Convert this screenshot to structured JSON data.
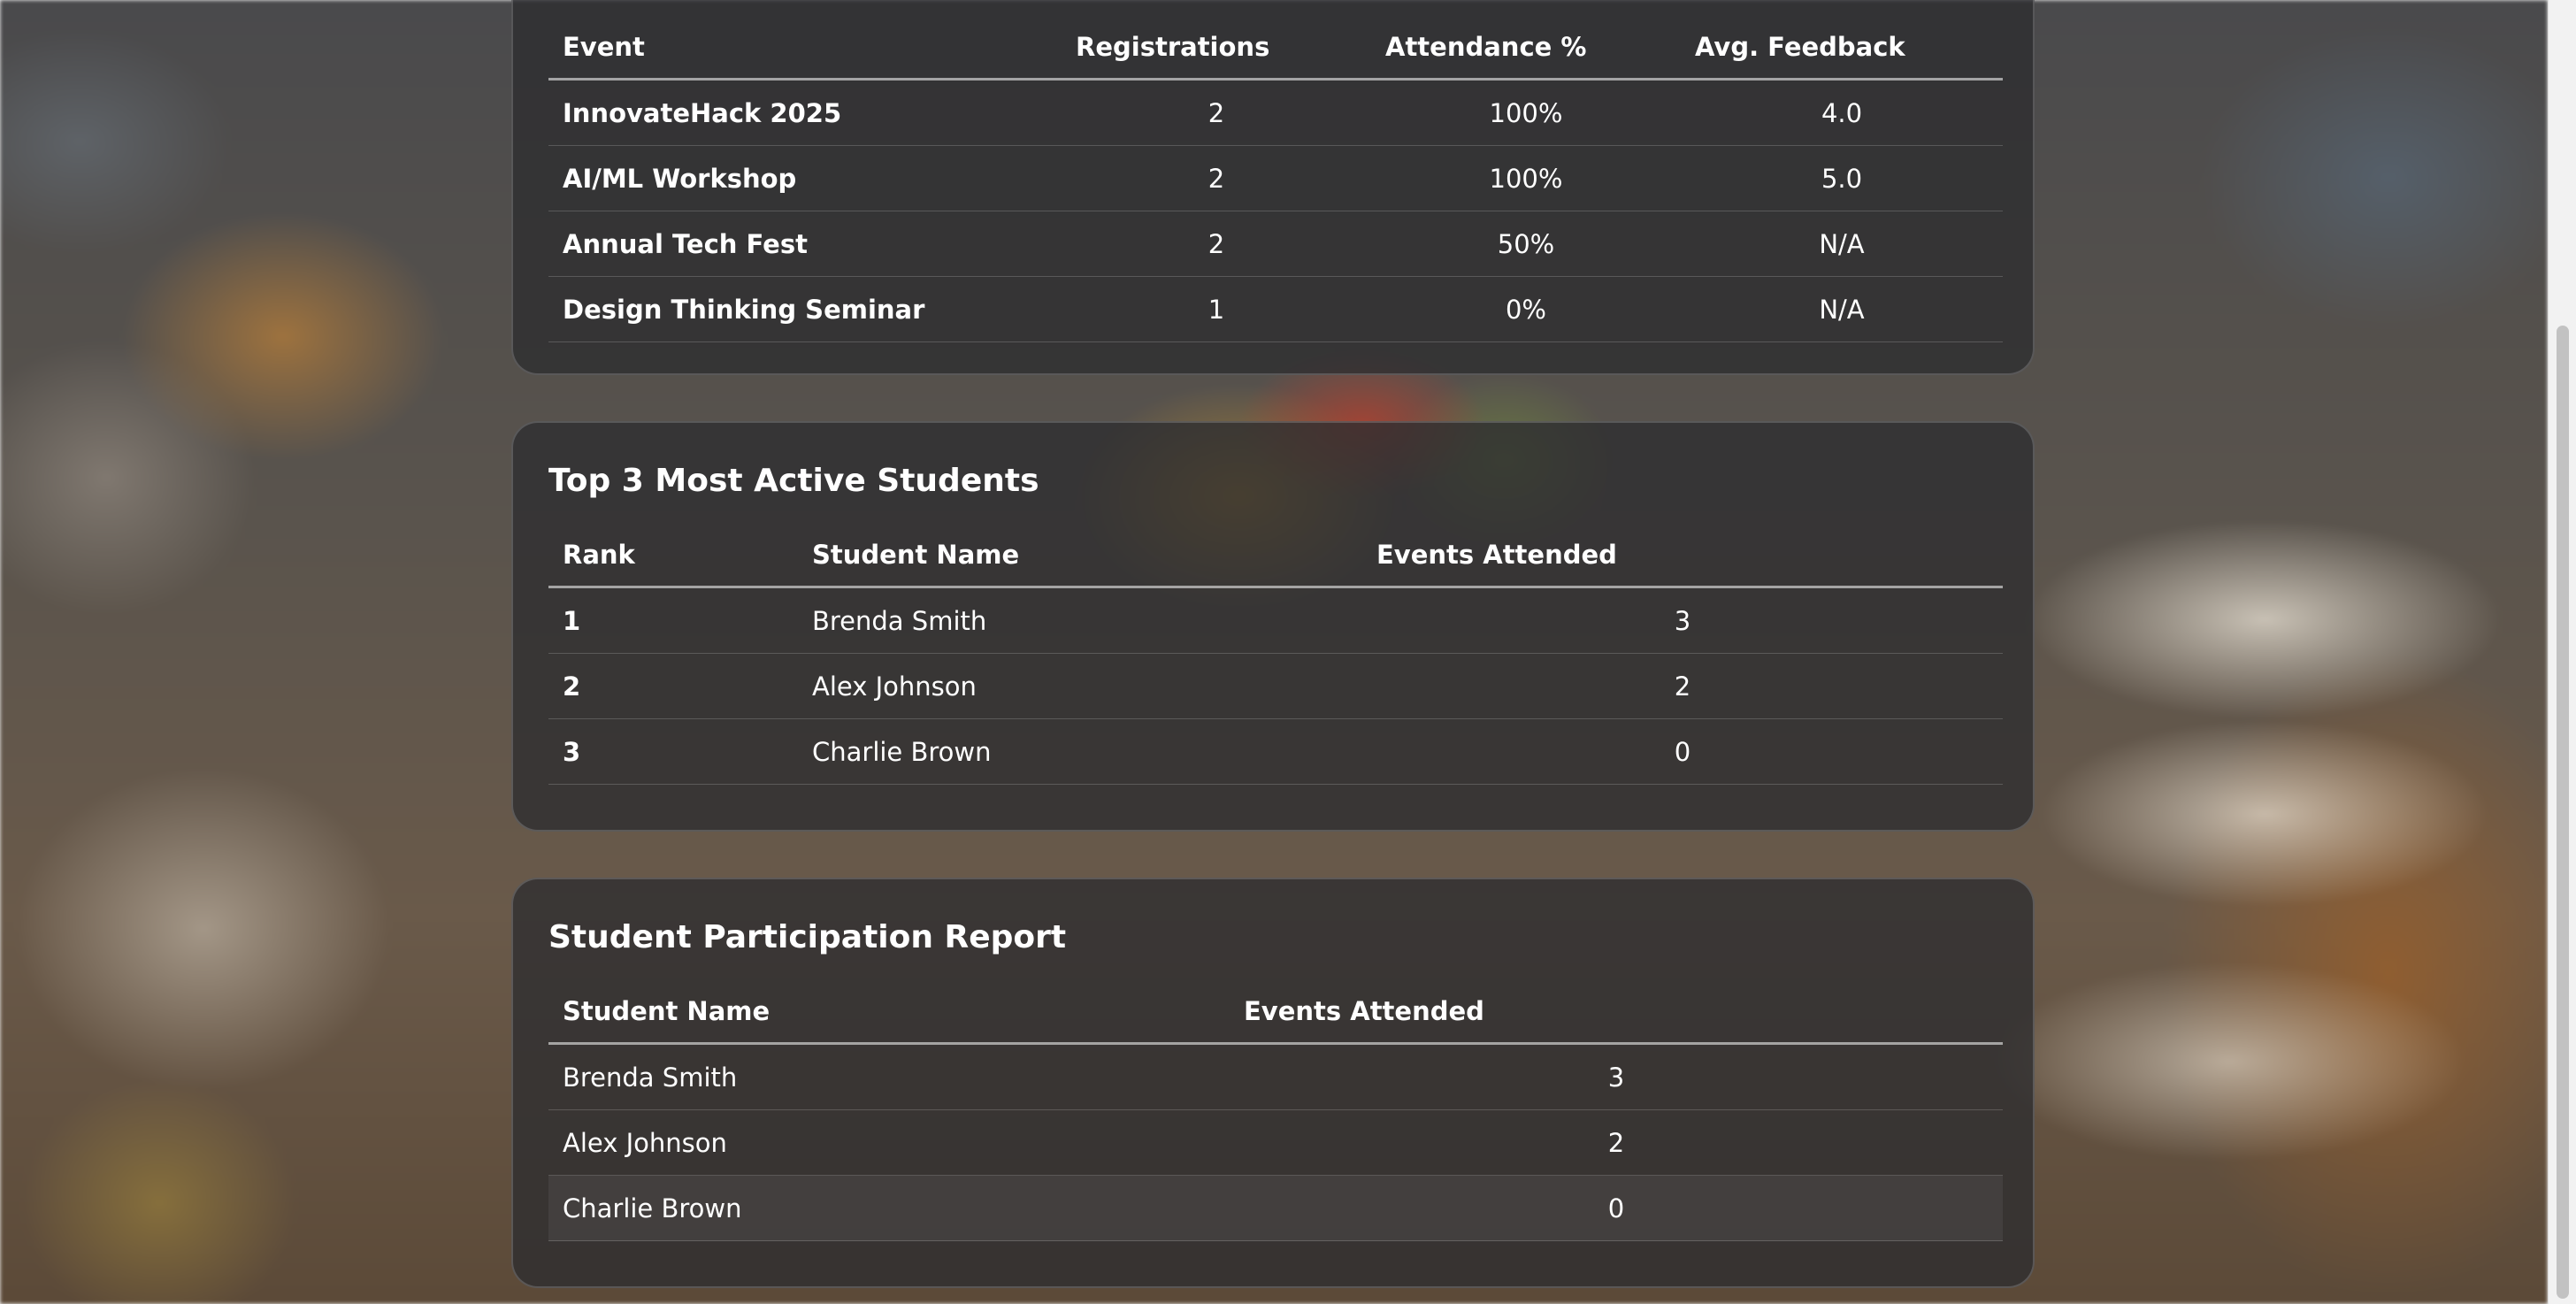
{
  "event_summary": {
    "columns": [
      "Event",
      "Registrations",
      "Attendance %",
      "Avg. Feedback"
    ],
    "rows": [
      {
        "event": "InnovateHack 2025",
        "registrations": "2",
        "attendance": "100%",
        "feedback": "4.0"
      },
      {
        "event": "AI/ML Workshop",
        "registrations": "2",
        "attendance": "100%",
        "feedback": "5.0"
      },
      {
        "event": "Annual Tech Fest",
        "registrations": "2",
        "attendance": "50%",
        "feedback": "N/A"
      },
      {
        "event": "Design Thinking Seminar",
        "registrations": "1",
        "attendance": "0%",
        "feedback": "N/A"
      }
    ]
  },
  "top_students": {
    "title": "Top 3 Most Active Students",
    "columns": [
      "Rank",
      "Student Name",
      "Events Attended"
    ],
    "rows": [
      {
        "rank": "1",
        "name": "Brenda Smith",
        "events": "3"
      },
      {
        "rank": "2",
        "name": "Alex Johnson",
        "events": "2"
      },
      {
        "rank": "3",
        "name": "Charlie Brown",
        "events": "0"
      }
    ]
  },
  "participation": {
    "title": "Student Participation Report",
    "columns": [
      "Student Name",
      "Events Attended"
    ],
    "rows": [
      {
        "name": "Brenda Smith",
        "events": "3"
      },
      {
        "name": "Alex Johnson",
        "events": "2"
      },
      {
        "name": "Charlie Brown",
        "events": "0"
      }
    ]
  }
}
